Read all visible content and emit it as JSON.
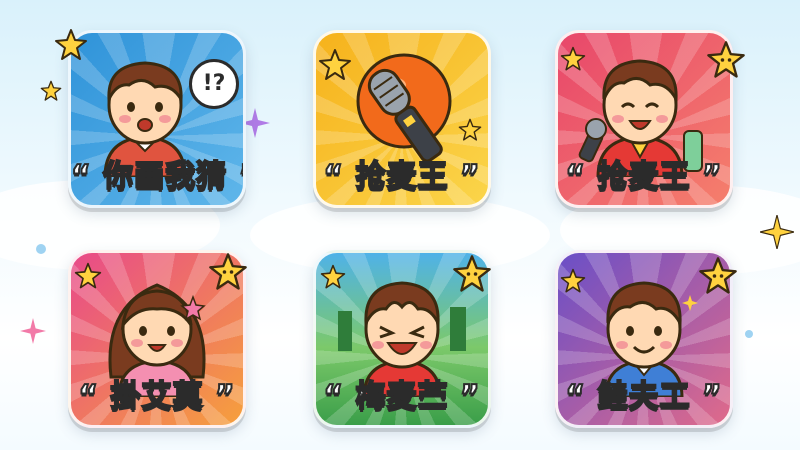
{
  "tiles": [
    {
      "caption": "“ 你画我猜 ”",
      "bg_from": "#2f93d9",
      "bg_to": "#5fb6ea",
      "subject": "boy-speech"
    },
    {
      "caption": "“ 抢麦王 ”",
      "bg_from": "#f6b21c",
      "bg_to": "#fbd54a",
      "subject": "microphone"
    },
    {
      "caption": "“ 抢麦王 ”",
      "bg_from": "#e8476b",
      "bg_to": "#f57f6c",
      "subject": "boy-mic"
    },
    {
      "caption": "“ 掛艾莫 ”",
      "bg_from": "#e84a8a",
      "bg_to": "#f6a03c",
      "subject": "girl"
    },
    {
      "caption": "“ 梅麦苎 ”",
      "bg_from": "#3a9e49",
      "bg_to": "#7cc96a",
      "subject": "boy-laughing"
    },
    {
      "caption": "“ 鲑夫工 ”",
      "bg_from": "#6a4fc7",
      "bg_to": "#e06a8a",
      "subject": "boy-smiling"
    }
  ],
  "speech_bubble_text": "!?",
  "colors": {
    "star": "#ffd23f",
    "star_outline": "#3a2a10",
    "skin": "#ffd9b3",
    "hair": "#7a3b1f"
  }
}
